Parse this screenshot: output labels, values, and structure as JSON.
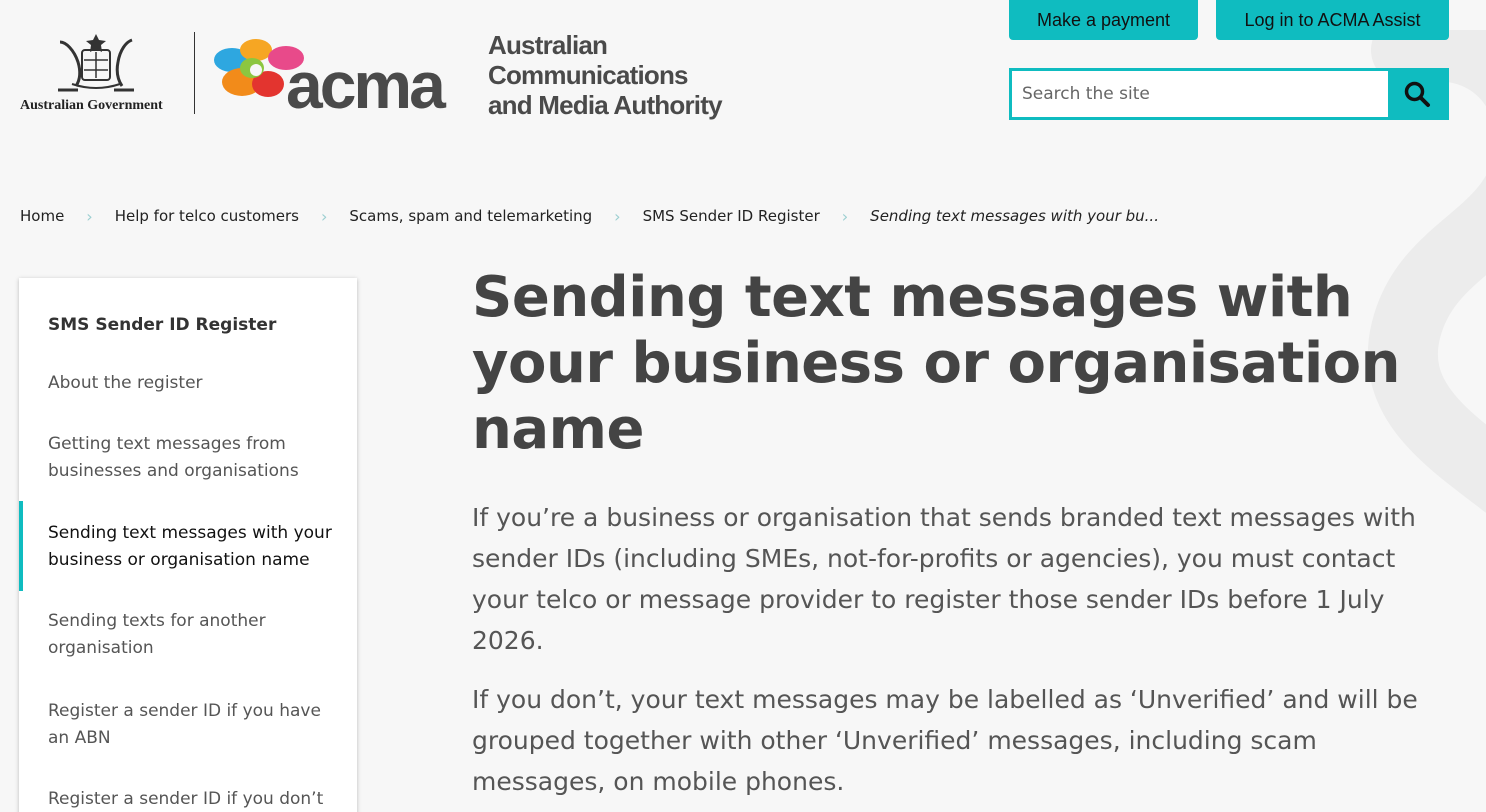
{
  "header": {
    "gov_label": "Australian Government",
    "acma_word": "acma",
    "acma_name_lines": [
      "Australian",
      "Communications",
      "and Media Authority"
    ],
    "make_payment_label": "Make a payment",
    "login_label": "Log in to ACMA Assist",
    "search": {
      "placeholder": "Search the site",
      "value": "",
      "button_icon": "search-icon"
    }
  },
  "breadcrumb": [
    "Home",
    "Help for telco customers",
    "Scams, spam and telemarketing",
    "SMS Sender ID Register",
    "Sending text messages with your bu..."
  ],
  "sidebar": {
    "title": "SMS Sender ID Register",
    "items": [
      {
        "label": "About the register"
      },
      {
        "label": "Getting text messages from businesses and organisations"
      },
      {
        "label": "Sending text messages with your business or organisation name",
        "active": true
      },
      {
        "label": "Sending texts for another organisation"
      },
      {
        "label": "Register a sender ID if you have an ABN"
      },
      {
        "label": "Register a sender ID if you don’t"
      }
    ]
  },
  "main": {
    "title": "Sending text messages with your business or organisation name",
    "paragraphs": [
      "If you’re a business or organisation that sends branded text messages with sender IDs (including SMEs, not-for-profits or agencies), you must contact your telco or message provider to register those sender IDs before 1 July 2026.",
      "If you don’t, your text messages may be labelled as ‘Unverified’ and will be grouped together with other ‘Unverified’ messages, including scam messages, on mobile phones."
    ]
  },
  "colors": {
    "accent": "#0fbcc0",
    "background": "#f7f7f7",
    "heading": "#444444"
  }
}
